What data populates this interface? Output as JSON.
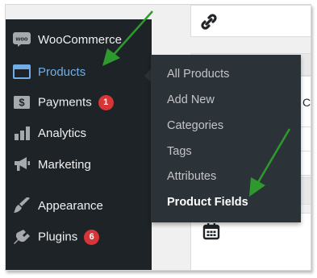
{
  "sidebar": {
    "items": [
      {
        "label": "WooCommerce",
        "icon": "woo-icon"
      },
      {
        "label": "Products",
        "icon": "products-icon",
        "active": true
      },
      {
        "label": "Payments",
        "icon": "payments-icon",
        "badge": "1"
      },
      {
        "label": "Analytics",
        "icon": "analytics-icon"
      },
      {
        "label": "Marketing",
        "icon": "megaphone-icon"
      },
      {
        "label": "Appearance",
        "icon": "brush-icon"
      },
      {
        "label": "Plugins",
        "icon": "plugin-icon",
        "badge": "6"
      }
    ]
  },
  "submenu": {
    "items": [
      {
        "label": "All Products"
      },
      {
        "label": "Add New"
      },
      {
        "label": "Categories"
      },
      {
        "label": "Tags"
      },
      {
        "label": "Attributes"
      },
      {
        "label": "Product Fields",
        "current": true
      }
    ]
  },
  "content": {
    "partial_text": "C"
  },
  "colors": {
    "sidebar_bg": "#1d2327",
    "flyout_bg": "#2c3338",
    "active_text": "#72aee6",
    "badge": "#d63638",
    "arrow": "#2e9a2e"
  }
}
